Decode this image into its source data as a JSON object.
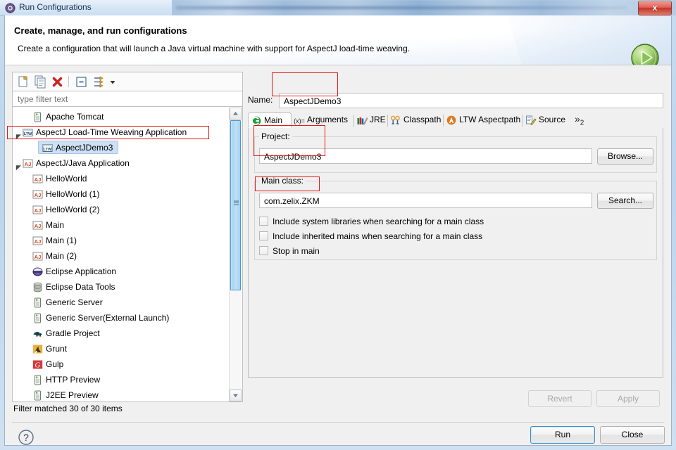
{
  "window": {
    "title": "Run Configurations",
    "title_icon": "run-config-icon",
    "close_label": "x"
  },
  "header": {
    "title": "Create, manage, and run configurations",
    "description": "Create a configuration that will launch a Java virtual machine with support for AspectJ load-time weaving.",
    "run_icon": "green-run-circle-icon"
  },
  "toolbar": {
    "buttons": [
      {
        "name": "new-launch-configuration",
        "icon": "new-document-icon"
      },
      {
        "name": "duplicate-launch-configuration",
        "icon": "copy-document-icon"
      },
      {
        "name": "delete-launch-configuration",
        "icon": "red-x-delete-icon"
      },
      {
        "name": "collapse-all",
        "icon": "collapse-all-icon"
      },
      {
        "name": "filter-launch-configurations",
        "icon": "filter-arrows-icon"
      },
      {
        "name": "view-menu",
        "icon": "chevron-down-icon"
      }
    ]
  },
  "filter": {
    "placeholder": "type filter text",
    "value": "",
    "status": "Filter matched 30 of 30 items"
  },
  "tree": {
    "items": [
      {
        "label": "Apache Tomcat",
        "icon": "server-icon",
        "indent": 1,
        "twisty": "none",
        "selected": false
      },
      {
        "label": "AspectJ Load-Time Weaving Application",
        "icon": "ltw-icon",
        "indent": 0,
        "twisty": "expanded",
        "selected": false
      },
      {
        "label": "AspectJDemo3",
        "icon": "ltw-icon",
        "indent": 2,
        "twisty": "none",
        "selected": true
      },
      {
        "label": "AspectJ/Java Application",
        "icon": "aj-icon",
        "indent": 0,
        "twisty": "expanded",
        "selected": false
      },
      {
        "label": "HelloWorld",
        "icon": "aj-icon",
        "indent": 1,
        "twisty": "none",
        "selected": false
      },
      {
        "label": "HelloWorld (1)",
        "icon": "aj-icon",
        "indent": 1,
        "twisty": "none",
        "selected": false
      },
      {
        "label": "HelloWorld (2)",
        "icon": "aj-icon",
        "indent": 1,
        "twisty": "none",
        "selected": false
      },
      {
        "label": "Main",
        "icon": "aj-icon",
        "indent": 1,
        "twisty": "none",
        "selected": false
      },
      {
        "label": "Main (1)",
        "icon": "aj-icon",
        "indent": 1,
        "twisty": "none",
        "selected": false
      },
      {
        "label": "Main (2)",
        "icon": "aj-icon",
        "indent": 1,
        "twisty": "none",
        "selected": false
      },
      {
        "label": "Eclipse Application",
        "icon": "eclipse-icon",
        "indent": 1,
        "twisty": "none",
        "selected": false
      },
      {
        "label": "Eclipse Data Tools",
        "icon": "database-icon",
        "indent": 1,
        "twisty": "none",
        "selected": false
      },
      {
        "label": "Generic Server",
        "icon": "server-icon",
        "indent": 1,
        "twisty": "none",
        "selected": false
      },
      {
        "label": "Generic Server(External Launch)",
        "icon": "server-icon",
        "indent": 1,
        "twisty": "none",
        "selected": false
      },
      {
        "label": "Gradle Project",
        "icon": "gradle-elephant-icon",
        "indent": 1,
        "twisty": "none",
        "selected": false
      },
      {
        "label": "Grunt",
        "icon": "grunt-icon",
        "indent": 1,
        "twisty": "none",
        "selected": false
      },
      {
        "label": "Gulp",
        "icon": "gulp-icon",
        "indent": 1,
        "twisty": "none",
        "selected": false
      },
      {
        "label": "HTTP Preview",
        "icon": "server-icon",
        "indent": 1,
        "twisty": "none",
        "selected": false
      },
      {
        "label": "J2EE Preview",
        "icon": "server-icon",
        "indent": 1,
        "twisty": "none",
        "selected": false
      }
    ]
  },
  "config": {
    "name_label": "Name:",
    "name_value": "AspectJDemo3",
    "tabs": [
      {
        "label": "Main",
        "icon": "main-green-c-icon",
        "active": true
      },
      {
        "label": "Arguments",
        "icon": "arguments-x-icon",
        "active": false
      },
      {
        "label": "JRE",
        "icon": "jre-books-icon",
        "active": false
      },
      {
        "label": "Classpath",
        "icon": "classpath-icon",
        "active": false
      },
      {
        "label": "LTW Aspectpath",
        "icon": "ltw-aspectpath-icon",
        "active": false
      },
      {
        "label": "Source",
        "icon": "source-pencil-icon",
        "active": false
      }
    ],
    "tab_overflow_label": "»",
    "tab_overflow_count": "2",
    "project_group_title": "Project:",
    "project_value": "AspectJDemo3",
    "browse_label": "Browse...",
    "main_class_group_title": "Main class:",
    "main_class_value": "com.zelix.ZKM",
    "search_label": "Search...",
    "checkboxes": [
      {
        "label": "Include system libraries when searching for a main class",
        "checked": false
      },
      {
        "label": "Include inherited mains when searching for a main class",
        "checked": false
      },
      {
        "label": "Stop in main",
        "checked": false
      }
    ],
    "revert_label": "Revert",
    "apply_label": "Apply"
  },
  "footer": {
    "help_icon": "help-question-icon",
    "run_label": "Run",
    "close_label": "Close"
  },
  "annotations": {
    "color": "#e01b1b",
    "boxes": [
      {
        "name": "highlight-tree-ltw-application"
      },
      {
        "name": "highlight-name-field"
      },
      {
        "name": "highlight-project-field"
      },
      {
        "name": "highlight-main-class-field"
      }
    ]
  }
}
